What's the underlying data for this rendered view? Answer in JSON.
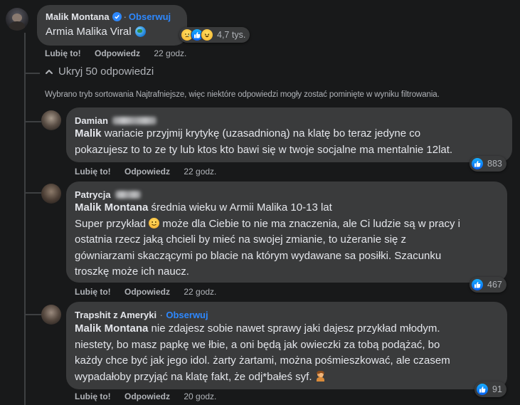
{
  "top_comment": {
    "author": "Malik Montana",
    "follow_label": "Obserwuj",
    "separator": "·",
    "text": "Armia Malika Viral",
    "reaction_count": "4,7 tys.",
    "like_label": "Lubię to!",
    "reply_label": "Odpowiedz",
    "time": "22 godz."
  },
  "replies_toggle": {
    "label": "Ukryj 50 odpowiedzi",
    "sort_notice": "Wybrano tryb sortowania Najtrafniejsze, więc niektóre odpowiedzi mogły zostać pominięte w wyniku filtrowania."
  },
  "replies": [
    {
      "author": "Damian",
      "mention": "Malik",
      "lines": [
        "wariacie przyjmij krytykę (uzasadnioną) na klatę bo teraz jedyne co",
        "pokazujesz to to ze ty lub ktos kto bawi się w twoje socjalne ma mentalnie 12lat."
      ],
      "reaction_count": "883",
      "like_label": "Lubię to!",
      "reply_label": "Odpowiedz",
      "time": "22 godz."
    },
    {
      "author": "Patrycja",
      "mention": "Malik Montana",
      "first_line_rest": "średnia wieku w Armii Malika 10-13 lat",
      "line2_a": "Super przykład",
      "line2_b": "może dla Ciebie to nie ma znaczenia, ale Ci ludzie są w pracy i",
      "lines": [
        "ostatnia rzecz jaką chcieli by mieć na swojej zmianie, to użeranie się z",
        "gówniarzami skaczącymi po blacie na którym wydawane sa posiłki. Szacunku",
        "troszkę może ich naucz."
      ],
      "reaction_count": "467",
      "like_label": "Lubię to!",
      "reply_label": "Odpowiedz",
      "time": "22 godz."
    },
    {
      "author": "Trapshit z Ameryki",
      "separator": "·",
      "follow_label": "Obserwuj",
      "mention": "Malik Montana",
      "first_line_rest": "nie zdajesz sobie nawet sprawy jaki dajesz przykład młodym.",
      "lines": [
        "niestety, bo masz papkę we łbie, a oni będą jak owieczki za tobą podążać, bo",
        "każdy chce być jak jego idol. żarty żartami, można pośmieszkować, ale czasem"
      ],
      "last_line": "wypadałoby przyjąć na klatę fakt, że odj*bałeś syf.",
      "reaction_count": "91",
      "like_label": "Lubię to!",
      "reply_label": "Odpowiedz",
      "time": "20 godz."
    }
  ],
  "colors": {
    "background": "#18191a",
    "bubble": "#3a3b3c",
    "text": "#e4e6eb",
    "secondary": "#b0b3b8",
    "link": "#2d88ff"
  }
}
